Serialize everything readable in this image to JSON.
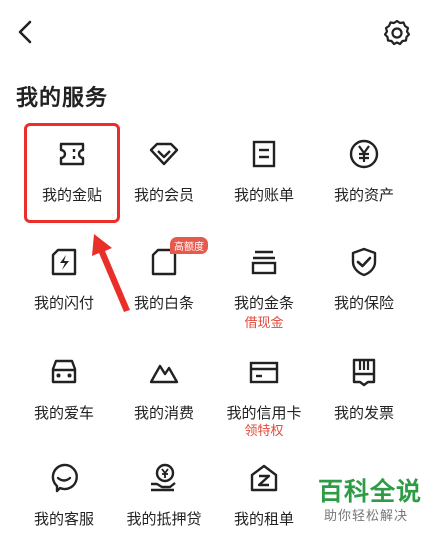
{
  "header": {
    "back_icon": "chevron-left-icon",
    "settings_icon": "gear-icon"
  },
  "section": {
    "title": "我的服务"
  },
  "services": [
    {
      "label": "我的金贴",
      "icon": "ticket-icon"
    },
    {
      "label": "我的会员",
      "icon": "diamond-icon"
    },
    {
      "label": "我的账单",
      "icon": "bill-icon"
    },
    {
      "label": "我的资产",
      "icon": "yen-circle-icon"
    },
    {
      "label": "我的闪付",
      "icon": "lightning-card-icon"
    },
    {
      "label": "我的白条",
      "icon": "folded-card-icon",
      "badge": "高额度"
    },
    {
      "label": "我的金条",
      "icon": "stack-icon",
      "sub": "借现金"
    },
    {
      "label": "我的保险",
      "icon": "shield-check-icon"
    },
    {
      "label": "我的爱车",
      "icon": "car-icon"
    },
    {
      "label": "我的消费",
      "icon": "mountain-icon"
    },
    {
      "label": "我的信用卡",
      "icon": "credit-card-icon",
      "sub": "领特权"
    },
    {
      "label": "我的发票",
      "icon": "receipt-icon"
    },
    {
      "label": "我的客服",
      "icon": "chat-bubble-icon"
    },
    {
      "label": "我的抵押贷",
      "icon": "hand-yen-icon"
    },
    {
      "label": "我的租单",
      "icon": "house-z-icon"
    }
  ],
  "colors": {
    "accent": "#e24a3b",
    "highlight": "#ea2f2a",
    "watermark": "#2e9b45"
  },
  "watermark": {
    "title": "百科全说",
    "subtitle": "助你轻松解决"
  }
}
